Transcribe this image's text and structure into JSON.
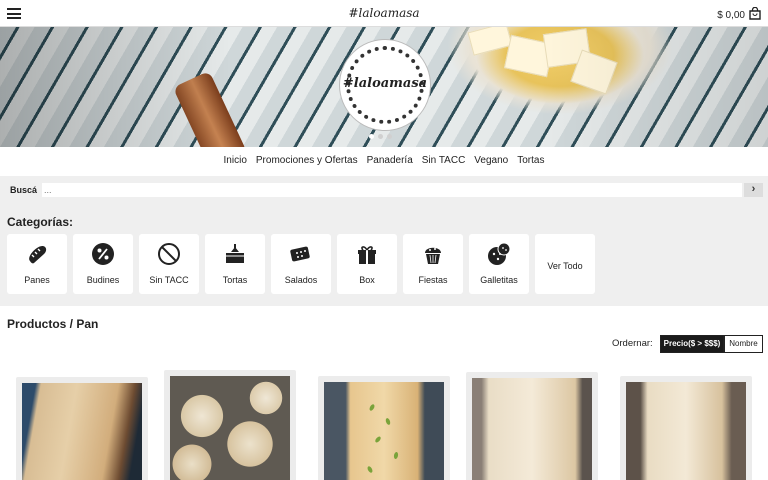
{
  "header": {
    "brand": "#laloamasa",
    "cart_total": "$ 0,00",
    "menu_icon": "hamburger-menu-icon",
    "cart_icon": "shopping-bag-icon"
  },
  "hero": {
    "logo_text": "#laloamasa",
    "slides": 3,
    "active_slide": 1
  },
  "nav": {
    "items": [
      {
        "label": "Inicio"
      },
      {
        "label": "Promociones y Ofertas"
      },
      {
        "label": "Panadería"
      },
      {
        "label": "Sin TACC"
      },
      {
        "label": "Vegano"
      },
      {
        "label": "Tortas"
      }
    ]
  },
  "search": {
    "label": "Buscá",
    "placeholder": "...",
    "value": "",
    "button_icon": "chevron-right-icon"
  },
  "categories": {
    "title": "Categorías:",
    "items": [
      {
        "label": "Panes",
        "icon": "bread-icon"
      },
      {
        "label": "Budines",
        "icon": "percent-badge-icon"
      },
      {
        "label": "Sin TACC",
        "icon": "prohibited-icon"
      },
      {
        "label": "Tortas",
        "icon": "cake-icon"
      },
      {
        "label": "Salados",
        "icon": "cracker-icon"
      },
      {
        "label": "Box",
        "icon": "gift-box-icon"
      },
      {
        "label": "Fiestas",
        "icon": "cupcake-icon"
      },
      {
        "label": "Galletitas",
        "icon": "cookie-icon"
      },
      {
        "label": "Ver Todo",
        "icon": ""
      }
    ]
  },
  "products": {
    "title": "Productos / Pan",
    "order_label": "Ordernar:",
    "sort_options": [
      {
        "label": "Precio($ > $$$)",
        "active": true
      },
      {
        "label": "Nombre",
        "active": false
      }
    ]
  },
  "colors": {
    "section_bg": "#efefef",
    "dark": "#1b1b1b",
    "text": "#222222"
  }
}
